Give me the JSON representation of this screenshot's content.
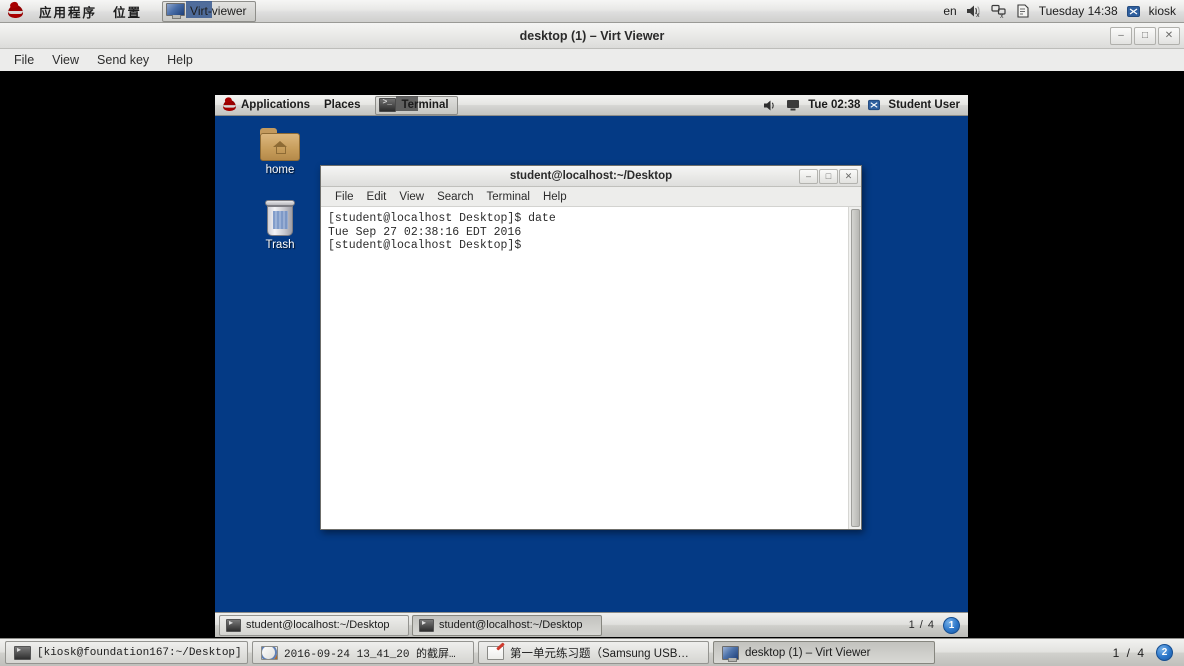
{
  "host_panel": {
    "applications_label": "应用程序",
    "places_label": "位置",
    "window_button_label": "Virt-viewer",
    "keyboard_layout": "en",
    "clock": "Tuesday 14:38",
    "user": "kiosk",
    "icons": [
      "redhat-logo-icon",
      "monitor-icon",
      "speaker-muted-icon",
      "network-disconnected-icon",
      "document-icon",
      "user-icon"
    ]
  },
  "virt_viewer": {
    "title": "desktop (1) – Virt Viewer",
    "menus": [
      "File",
      "View",
      "Send key",
      "Help"
    ],
    "window_controls": {
      "minimize": "–",
      "maximize": "□",
      "close": "✕"
    }
  },
  "guest_panel": {
    "applications_label": "Applications",
    "places_label": "Places",
    "window_button_label": "Terminal",
    "clock": "Tue 02:38",
    "user": "Student User"
  },
  "desktop": {
    "background_color": "#043a85",
    "icons": [
      {
        "name": "home-folder-icon",
        "label": "home"
      },
      {
        "name": "trash-icon",
        "label": "Trash"
      }
    ]
  },
  "terminal": {
    "title": "student@localhost:~/Desktop",
    "menus": [
      "File",
      "Edit",
      "View",
      "Search",
      "Terminal",
      "Help"
    ],
    "window_controls": {
      "minimize": "–",
      "maximize": "□",
      "close": "✕"
    },
    "content": "[student@localhost Desktop]$ date\nTue Sep 27 02:38:16 EDT 2016\n[student@localhost Desktop]$ "
  },
  "guest_taskbar": {
    "tasks": [
      {
        "label": "student@localhost:~/Desktop",
        "icon": "terminal-icon",
        "active": false
      },
      {
        "label": "student@localhost:~/Desktop",
        "icon": "terminal-icon",
        "active": true
      }
    ],
    "workspace_count": "1 / 4",
    "workspace_badge": "1"
  },
  "host_taskbar": {
    "tasks": [
      {
        "label": "[kiosk@foundation167:~/Desktop]",
        "icon": "terminal-icon",
        "active": false
      },
      {
        "label": "2016-09-24 13_41_20 的截屏…",
        "icon": "image-viewer-icon",
        "active": false
      },
      {
        "label": "第一单元练习题（Samsung USB…",
        "icon": "text-editor-icon",
        "active": false
      },
      {
        "label": "desktop (1) – Virt Viewer",
        "icon": "monitor-icon",
        "active": true
      }
    ],
    "workspace_count": "1 / 4",
    "workspace_badge": "2"
  }
}
